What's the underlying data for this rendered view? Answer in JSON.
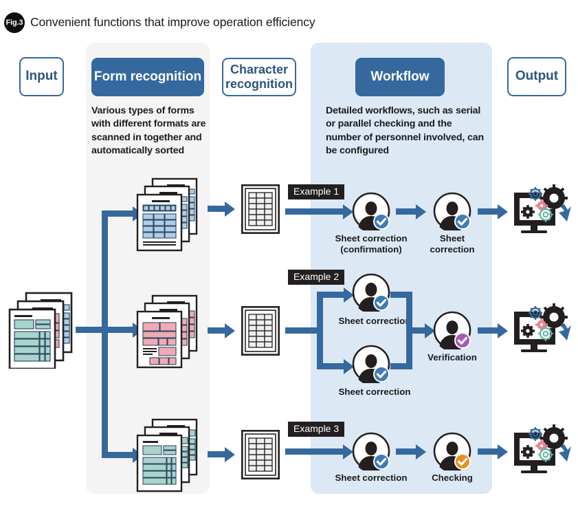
{
  "figure": {
    "badge": "Fig.3",
    "title": "Convenient functions that improve operation efficiency"
  },
  "colors": {
    "accent_blue": "#35699e",
    "panel_gray": "#f4f4f4",
    "panel_blue": "#dce8f4",
    "tag_black": "#231f20",
    "badge_blue": "#3f7cb4",
    "badge_purple": "#a45bb0",
    "badge_orange": "#e89020",
    "doc_blue": "#aecde8",
    "doc_pink": "#f0aab4",
    "doc_green": "#a9d4cc"
  },
  "stages": {
    "input": {
      "label": "Input"
    },
    "form_recognition": {
      "label": "Form recognition",
      "description": "Various types of forms with different formats are scanned in together and automatically sorted"
    },
    "character_recognition": {
      "label": "Character recognition"
    },
    "workflow": {
      "label": "Workflow",
      "description": "Detailed workflows, such as serial or parallel checking and the number of personnel involved, can be configured"
    },
    "output": {
      "label": "Output"
    }
  },
  "examples": [
    {
      "tag": "Example 1",
      "type": "serial",
      "steps": [
        {
          "label": "Sheet correction\n(confirmation)",
          "line1": "Sheet correction",
          "line2": "(confirmation)",
          "badge": "check-blue"
        },
        {
          "label": "Sheet correction",
          "line1": "Sheet",
          "line2": "correction",
          "badge": "check-blue"
        }
      ]
    },
    {
      "tag": "Example 2",
      "type": "parallel",
      "steps": [
        {
          "label": "Sheet correction",
          "line1": "Sheet correction",
          "line2": "",
          "badge": "check-blue"
        },
        {
          "label": "Sheet correction",
          "line1": "Sheet correction",
          "line2": "",
          "badge": "check-blue"
        },
        {
          "label": "Verification",
          "line1": "Verification",
          "line2": "",
          "badge": "check-purple"
        }
      ]
    },
    {
      "tag": "Example 3",
      "type": "serial",
      "steps": [
        {
          "label": "Sheet correction",
          "line1": "Sheet correction",
          "line2": "",
          "badge": "check-blue"
        },
        {
          "label": "Checking",
          "line1": "Checking",
          "line2": "",
          "badge": "check-orange"
        }
      ]
    }
  ],
  "artwork": {
    "input_docs": "mixed-document-stack",
    "form_stacks": [
      "blue-form-stack",
      "pink-form-stack",
      "green-form-stack"
    ],
    "tables": [
      "recognized-table",
      "recognized-table",
      "recognized-table"
    ],
    "outputs": [
      "monitor-gears",
      "monitor-gears",
      "monitor-gears"
    ]
  }
}
